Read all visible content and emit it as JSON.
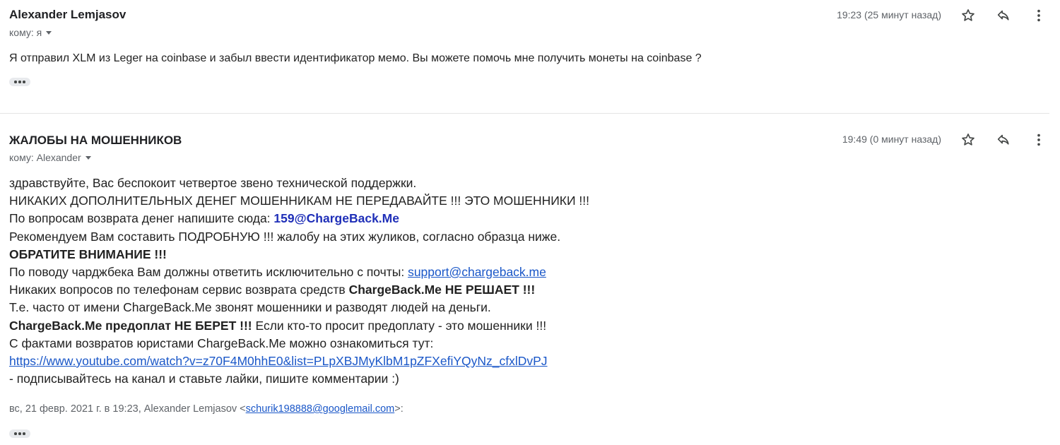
{
  "message1": {
    "sender": "Alexander Lemjasov",
    "recipient_label": "кому: я",
    "time": "19:23 (25 минут назад)",
    "body": "Я отправил XLM из Leger на coinbase  и забыл ввести идентификатор мемо. Вы можете помочь мне получить монеты на coinbase ?",
    "icons": [
      "star-icon",
      "reply-icon",
      "more-vert-icon"
    ]
  },
  "message2": {
    "sender": "ЖАЛОБЫ НА МОШЕННИКОВ",
    "recipient_label": "кому: Alexander",
    "time": "19:49 (0 минут назад)",
    "icons": [
      "star-icon",
      "reply-icon",
      "more-vert-icon"
    ],
    "body": {
      "line1": "здравствуйте, Вас беспокоит четвертое звено технической поддержки.",
      "line2": "НИКАКИХ ДОПОЛНИТЕЛЬНЫХ ДЕНЕГ МОШЕННИКАМ НЕ ПЕРЕДАВАЙТЕ !!! ЭТО МОШЕННИКИ !!!",
      "line3_prefix": "По вопросам возврата денег напишите сюда: ",
      "line3_email": "159@ChargeBack.Me",
      "line4": "Рекомендуем Вам составить ПОДРОБНУЮ !!! жалобу на этих жуликов, согласно образца ниже.",
      "line5": "ОБРАТИТЕ ВНИМАНИЕ !!!",
      "line6_prefix": "По поводу чарджбека Вам должны ответить исключительно с почты: ",
      "line6_link": "support@chargeback.me",
      "line7_prefix": "Никаких вопросов по телефонам сервис возврата средств ",
      "line7_bold": "ChargeBack.Me НЕ РЕШАЕТ !!!",
      "line8": "Т.е. часто от имени ChargeBack.Me звонят мошенники и разводят людей на деньги.",
      "line9_bold": "ChargeBack.Me предоплат НЕ БЕРЕТ !!!",
      "line9_rest": " Если кто-то просит предоплату - это мошенники !!!",
      "line10": "С фактами возвратов юристами ChargeBack.Me можно ознакомиться тут:",
      "line11_link": "https://www.youtube.com/watch?v=z70F4M0hhE0&list=PLpXBJMyKlbM1pZFXefiYQyNz_cfxlDvPJ",
      "line12": " - подписывайтесь на канал и ставьте лайки, пишите комментарии :)"
    },
    "quote": {
      "prefix": "вс, 21 февр. 2021 г. в 19:23, Alexander Lemjasov <",
      "email": "schurik198888@googlemail.com",
      "suffix": ">:"
    }
  },
  "colors": {
    "link": "#1a57c8",
    "bold_email": "#1f2fb8",
    "muted_text": "#5f6368",
    "divider": "#e4e4e4"
  }
}
